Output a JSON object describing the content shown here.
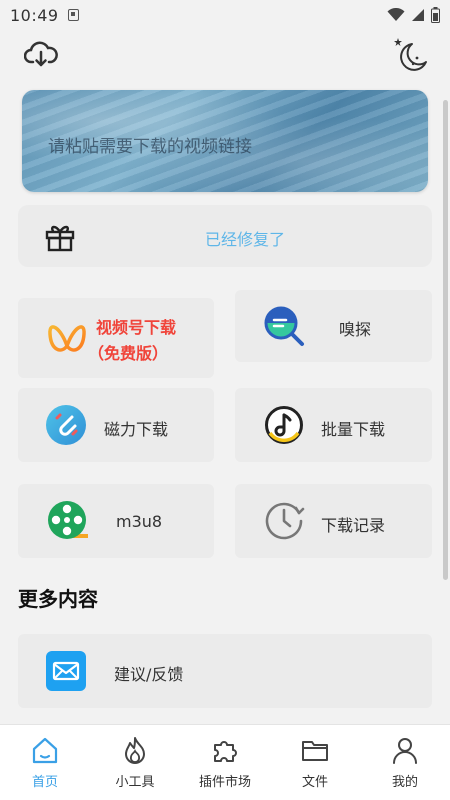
{
  "status_bar": {
    "time": "10:49"
  },
  "search": {
    "placeholder": "请粘贴需要下载的视频链接"
  },
  "repair_card": {
    "message": "已经修复了"
  },
  "tools": [
    {
      "label_line1": "视频号下载",
      "label_line2": "（免费版）",
      "icon": "butterfly-icon",
      "accent": "#f0443a"
    },
    {
      "label": "嗅探",
      "icon": "sniff-icon"
    },
    {
      "label": "磁力下载",
      "icon": "magnet-icon"
    },
    {
      "label": "批量下载",
      "icon": "music-note-icon"
    },
    {
      "label": "m3u8",
      "icon": "film-reel-icon"
    },
    {
      "label": "下载记录",
      "icon": "clock-icon"
    }
  ],
  "more_section": {
    "title": "更多内容",
    "items": [
      {
        "label": "建议/反馈",
        "icon": "mail-icon"
      }
    ]
  },
  "bottom_nav": [
    {
      "label": "首页",
      "icon": "home-icon",
      "active": true
    },
    {
      "label": "小工具",
      "icon": "flame-icon"
    },
    {
      "label": "插件市场",
      "icon": "puzzle-icon"
    },
    {
      "label": "文件",
      "icon": "folder-icon"
    },
    {
      "label": "我的",
      "icon": "user-icon"
    }
  ],
  "colors": {
    "accent_blue": "#3aa0e6",
    "repair_text": "#5fb6e8",
    "highlight_red": "#f0443a",
    "card_bg": "#ebebeb"
  }
}
